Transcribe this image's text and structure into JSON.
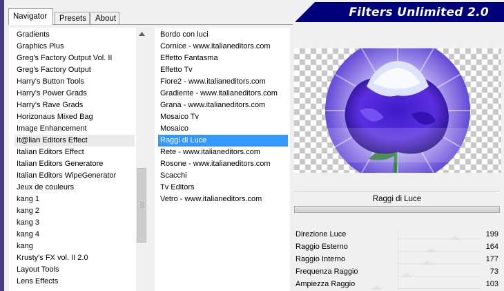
{
  "tabs": [
    "Navigator",
    "Presets",
    "About"
  ],
  "banner": {
    "title": "Filters Unlimited 2.0"
  },
  "categories": {
    "items": [
      "Gradients",
      "Graphics Plus",
      "Greg's Factory Output Vol. II",
      "Greg's Factory Output",
      "Harry's Button Tools",
      "Harry's Power Grads",
      "Harry's Rave Grads",
      "Horizonaus Mixed Bag",
      "Image Enhancement",
      "It@lian Editors Effect",
      "Italian Editors Effect",
      "Italian Editors Generatore",
      "Italian Editors WipeGenerator",
      "Jeux de couleurs",
      "kang 1",
      "kang 2",
      "kang 3",
      "kang 4",
      "kang",
      "Krusty's FX vol. II 2.0",
      "Layout Tools",
      "Lens Effects"
    ],
    "highlighted": "It@lian Editors Effect"
  },
  "filters": {
    "items": [
      "Bordo con luci",
      "Cornice - www.italianeditors.com",
      "Effetto Fantasma",
      "Effetto Tv",
      "Fiore2 - www.italianeditors.com",
      "Gradiente - www.italianeditors.com",
      "Grana - www.italianeditors.com",
      "Mosaico Tv",
      "Mosaico",
      "Raggi di Luce",
      "Rete - www.italianeditors.com",
      "Rosone - www.italianeditors.com",
      "Scacchi",
      "Tv Editors",
      "Vetro - www.italianeditors.com"
    ],
    "selected": "Raggi di Luce"
  },
  "preview": {
    "filter_name": "Raggi di Luce"
  },
  "parameters": [
    {
      "label": "Direzione Luce",
      "value": 199
    },
    {
      "label": "Raggio Esterno",
      "value": 164
    },
    {
      "label": "Raggio Interno",
      "value": 177
    },
    {
      "label": "Frequenza Raggio",
      "value": 73
    },
    {
      "label": "Ampiezza Raggio",
      "value": 103
    }
  ],
  "colors": {
    "banner": "#00007c",
    "selection": "#3399ff",
    "highlight": "#ebebeb"
  },
  "icons": {
    "scroll_up": "triangle-up-icon"
  }
}
